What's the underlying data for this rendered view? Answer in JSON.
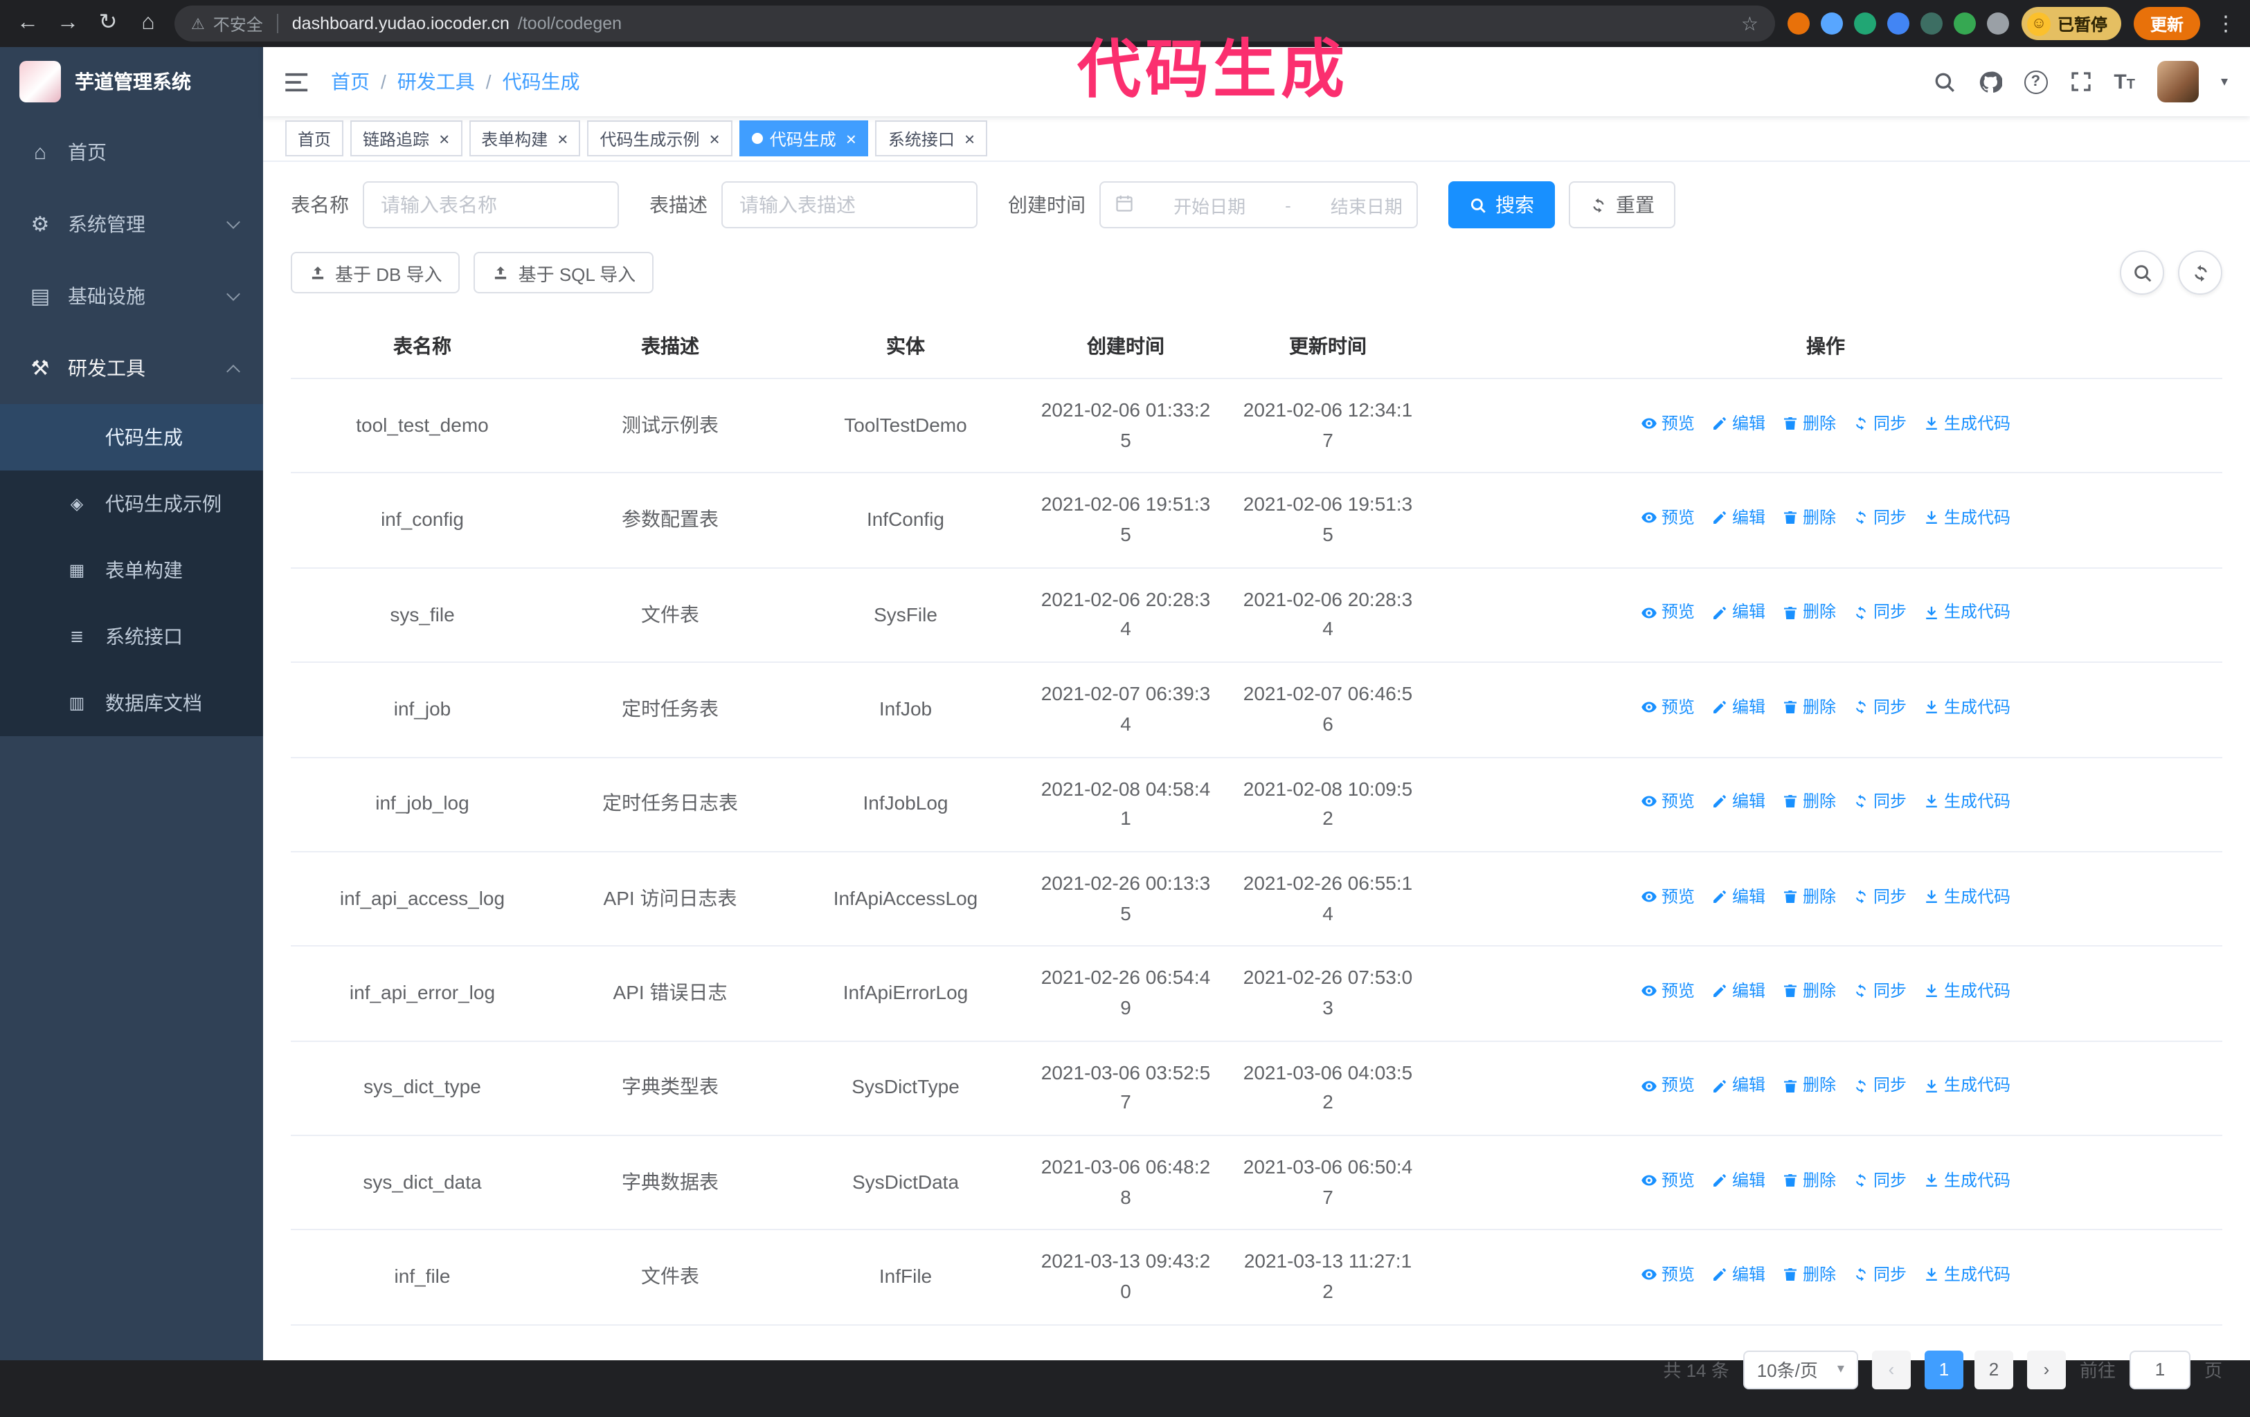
{
  "colors": {
    "primary": "#1890ff",
    "tab_active": "#409eff",
    "sidebar_bg": "#304156",
    "sidebar_submenu_bg": "#1f2d3d",
    "annotation": "#fb2f6f"
  },
  "annotation": {
    "text": "代码生成"
  },
  "browser": {
    "nav_icons": [
      "back",
      "forward",
      "reload",
      "home"
    ],
    "security_label": "不安全",
    "url_host": "dashboard.yudao.iocoder.cn",
    "url_path": "/tool/codegen",
    "extensions": [
      {
        "name": "extension-orange",
        "color": "#e8710a"
      },
      {
        "name": "extension-blue-drop",
        "color": "#58a6ff"
      },
      {
        "name": "extension-green-check",
        "color": "#21a674"
      },
      {
        "name": "extension-people",
        "color": "#4285f4"
      },
      {
        "name": "extension-teal",
        "color": "#3d6e63"
      },
      {
        "name": "extension-leaf",
        "color": "#36a852"
      },
      {
        "name": "extension-puzzle",
        "color": "#9aa0a6"
      }
    ],
    "profile_label": "已暂停",
    "update_label": "更新"
  },
  "sidebar": {
    "title": "芋道管理系统",
    "items": [
      {
        "id": "home",
        "label": "首页",
        "icon": "home"
      },
      {
        "id": "system",
        "label": "系统管理",
        "icon": "gear",
        "chevron": "down"
      },
      {
        "id": "infra",
        "label": "基础设施",
        "icon": "infrastructure",
        "chevron": "down"
      },
      {
        "id": "devtools",
        "label": "研发工具",
        "icon": "tools",
        "chevron": "up",
        "expanded": true
      }
    ],
    "subitems": [
      {
        "id": "codegen",
        "label": "代码生成",
        "icon": "code",
        "active": true
      },
      {
        "id": "codegen-demo",
        "label": "代码生成示例",
        "icon": "demo"
      },
      {
        "id": "form-builder",
        "label": "表单构建",
        "icon": "form"
      },
      {
        "id": "api",
        "label": "系统接口",
        "icon": "api"
      },
      {
        "id": "db-doc",
        "label": "数据库文档",
        "icon": "database"
      }
    ]
  },
  "navbar": {
    "breadcrumb": [
      "首页",
      "研发工具",
      "代码生成"
    ],
    "icons": [
      "search",
      "github",
      "help",
      "fullscreen",
      "font-size"
    ]
  },
  "tabs": [
    {
      "id": "home",
      "label": "首页",
      "closable": false,
      "active": false
    },
    {
      "id": "tracing",
      "label": "链路追踪",
      "closable": true,
      "active": false
    },
    {
      "id": "form-builder",
      "label": "表单构建",
      "closable": true,
      "active": false
    },
    {
      "id": "codegen-demo",
      "label": "代码生成示例",
      "closable": true,
      "active": false
    },
    {
      "id": "codegen",
      "label": "代码生成",
      "closable": true,
      "active": true
    },
    {
      "id": "api",
      "label": "系统接口",
      "closable": true,
      "active": false
    }
  ],
  "filters": {
    "table_name_label": "表名称",
    "table_name_placeholder": "请输入表名称",
    "table_desc_label": "表描述",
    "table_desc_placeholder": "请输入表描述",
    "create_time_label": "创建时间",
    "date_start_placeholder": "开始日期",
    "date_separator": "-",
    "date_end_placeholder": "结束日期",
    "search_label": "搜索",
    "reset_label": "重置"
  },
  "toolbar": {
    "import_db": "基于 DB 导入",
    "import_sql": "基于 SQL 导入"
  },
  "table": {
    "columns": [
      "表名称",
      "表描述",
      "实体",
      "创建时间",
      "更新时间",
      "操作"
    ],
    "actions": [
      "预览",
      "编辑",
      "删除",
      "同步",
      "生成代码"
    ],
    "rows": [
      {
        "name": "tool_test_demo",
        "desc": "测试示例表",
        "entity": "ToolTestDemo",
        "created": "2021-02-06 01:33:25",
        "updated": "2021-02-06 12:34:17"
      },
      {
        "name": "inf_config",
        "desc": "参数配置表",
        "entity": "InfConfig",
        "created": "2021-02-06 19:51:35",
        "updated": "2021-02-06 19:51:35"
      },
      {
        "name": "sys_file",
        "desc": "文件表",
        "entity": "SysFile",
        "created": "2021-02-06 20:28:34",
        "updated": "2021-02-06 20:28:34"
      },
      {
        "name": "inf_job",
        "desc": "定时任务表",
        "entity": "InfJob",
        "created": "2021-02-07 06:39:34",
        "updated": "2021-02-07 06:46:56"
      },
      {
        "name": "inf_job_log",
        "desc": "定时任务日志表",
        "entity": "InfJobLog",
        "created": "2021-02-08 04:58:41",
        "updated": "2021-02-08 10:09:52"
      },
      {
        "name": "inf_api_access_log",
        "desc": "API 访问日志表",
        "entity": "InfApiAccessLog",
        "created": "2021-02-26 00:13:35",
        "updated": "2021-02-26 06:55:14"
      },
      {
        "name": "inf_api_error_log",
        "desc": "API 错误日志",
        "entity": "InfApiErrorLog",
        "created": "2021-02-26 06:54:49",
        "updated": "2021-02-26 07:53:03"
      },
      {
        "name": "sys_dict_type",
        "desc": "字典类型表",
        "entity": "SysDictType",
        "created": "2021-03-06 03:52:57",
        "updated": "2021-03-06 04:03:52"
      },
      {
        "name": "sys_dict_data",
        "desc": "字典数据表",
        "entity": "SysDictData",
        "created": "2021-03-06 06:48:28",
        "updated": "2021-03-06 06:50:47"
      },
      {
        "name": "inf_file",
        "desc": "文件表",
        "entity": "InfFile",
        "created": "2021-03-13 09:43:20",
        "updated": "2021-03-13 11:27:12"
      }
    ]
  },
  "pagination": {
    "total_text": "共 14 条",
    "page_size": "10条/页",
    "pages": [
      "1",
      "2"
    ],
    "active_page": "1",
    "goto_prefix": "前往",
    "goto_value": "1",
    "goto_suffix": "页"
  }
}
